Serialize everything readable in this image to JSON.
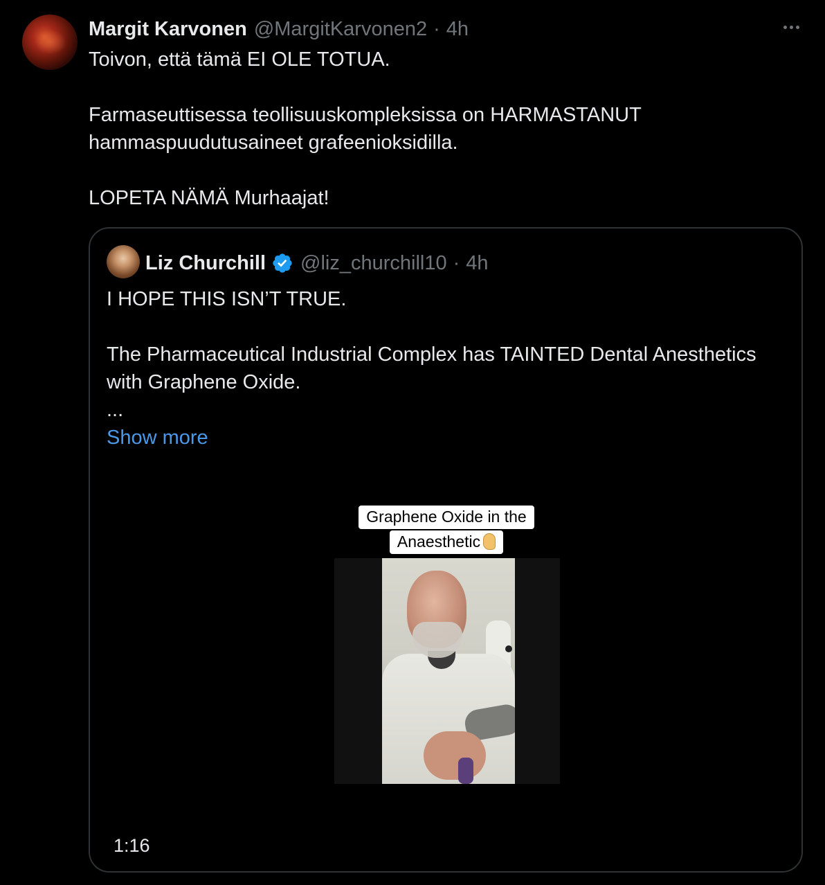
{
  "tweet": {
    "author_name": "Margit Karvonen",
    "author_handle": "@MargitKarvonen2",
    "separator": "·",
    "time": "4h",
    "avatar_icon": "user-avatar",
    "more_icon": "more-options-icon",
    "paragraphs": [
      "Toivon, että tämä EI OLE TOTUA.",
      "Farmaseuttisessa teollisuuskompleksissa on HARMASTANUT hammaspuudutusaineet grafeenioksidilla.",
      "LOPETA NÄMÄ Murhaajat!"
    ]
  },
  "quote": {
    "author_name": "Liz Churchill",
    "verified_icon": "verified-badge-icon",
    "author_handle": "@liz_churchill10",
    "separator": "·",
    "time": "4h",
    "paragraphs": [
      "I HOPE THIS ISN’T TRUE.",
      "The Pharmaceutical Industrial Complex has TAINTED Dental Anesthetics with Graphene Oxide.",
      "..."
    ],
    "show_more_label": "Show more",
    "media": {
      "caption_line1": "Graphene Oxide in the",
      "caption_line2": "Anaesthetic",
      "caption_icon": "ear-emoji-icon",
      "duration": "1:16"
    }
  },
  "colors": {
    "background": "#000000",
    "text_primary": "#e7e9ea",
    "text_secondary": "#71767b",
    "link": "#4a99e9",
    "border": "#2f3336",
    "verified": "#1d9bf0"
  }
}
